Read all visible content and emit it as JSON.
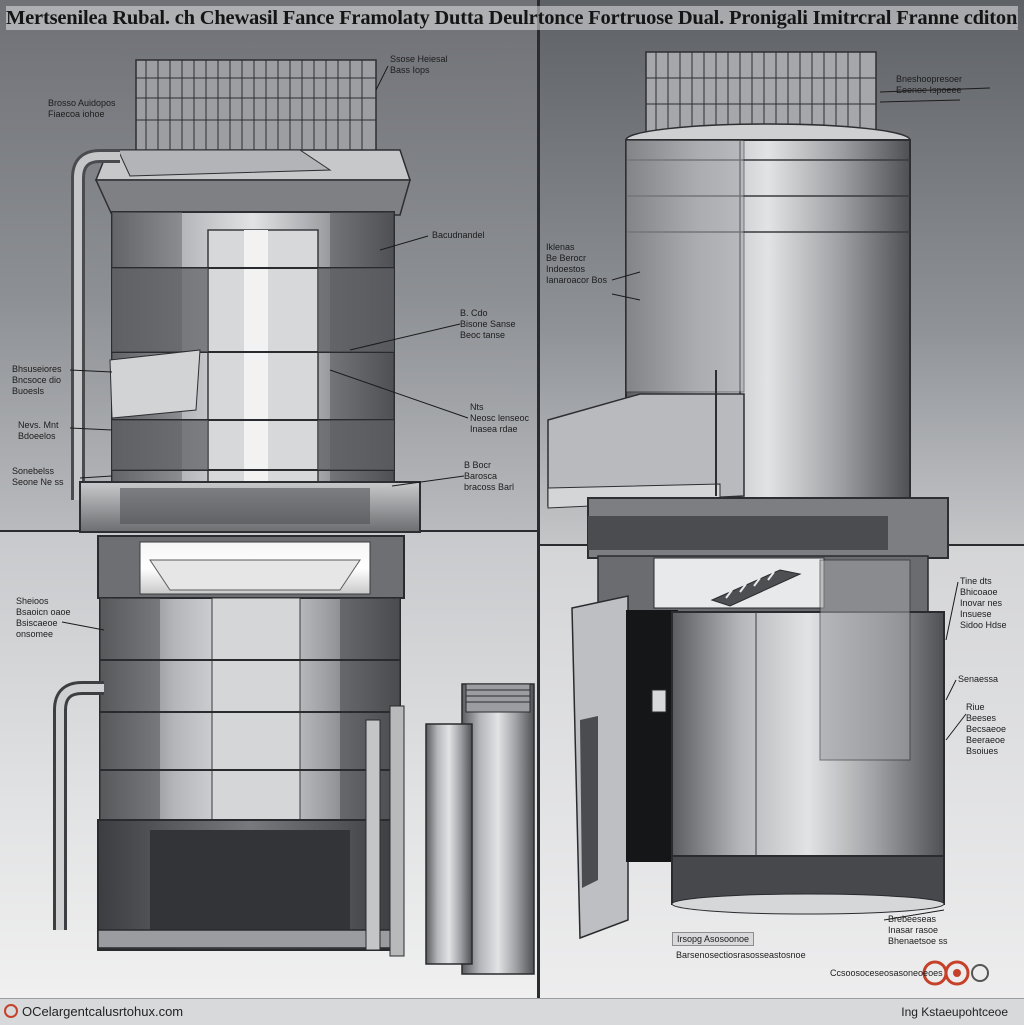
{
  "title": "Mertsenilea Rubal. ch Chewasil Fance Framolaty Dutta Deulrtonce Fortruose Dual. Pronigali Imitrcral Franne cditon)",
  "callouts": {
    "tl_top": "Ssose Heiesal\nBass Iops",
    "tl_upper_left": "Brosso Auidopos\nFiaecoa iohoe",
    "tl_right_1": "Bacudnandel",
    "tl_right_2": "B. Cdo\nBisone Sanse\nBeoc tanse",
    "tl_left_1": "Bhsuseiores\nBncsoce dio\nBuoesls",
    "tl_left_2": "Nevs. Mnt\nBdoeelos",
    "tl_right_3": "Nts\nNeosc lenseoc\nInasea rdae",
    "tl_left_3": "Sonebelss\nSeone Ne ss",
    "tl_right_4": "B Bocr\nBarosca\nbracoss Barl",
    "tr_top": "Bneshoopresoer\nEeenoe Ispoeee",
    "tr_left_1": "Iklenas\nBe Berocr\nIndoestos\nIanaroacor Bos",
    "bl_left_1": "Sheioos\nBsaoicn oaoe\nBsiscaeoe\nonsomee",
    "br_right_1": "Tine dts\nBhicoaoe\nInovar nes\nInsuese\nSidoo Hdse",
    "br_right_2": "Senaessa",
    "br_right_3": "Riue\nBeeses\nBecsaeoe\nBeeraeoe\nBsoiues",
    "br_bottom_right": "Brebeeseas\nInasar rasoe\nBhenaetsoe ss",
    "br_box_label": "Irsopg Asosoonoe",
    "br_bottom_caption": "Barsenosectiosrasosseastosnoe",
    "br_bottom_small": "Ccsoosoceseosasoneoeoes"
  },
  "footer": {
    "left": "OCelargentcalusrtohux.com",
    "right": "Ing Kstaeupohtceoe"
  },
  "colors": {
    "metal_dark": "#4a4b4e",
    "metal_mid": "#8e9094",
    "metal_light": "#d4d6d8",
    "accent_red": "#c6412a",
    "background": "#7c7f84"
  }
}
